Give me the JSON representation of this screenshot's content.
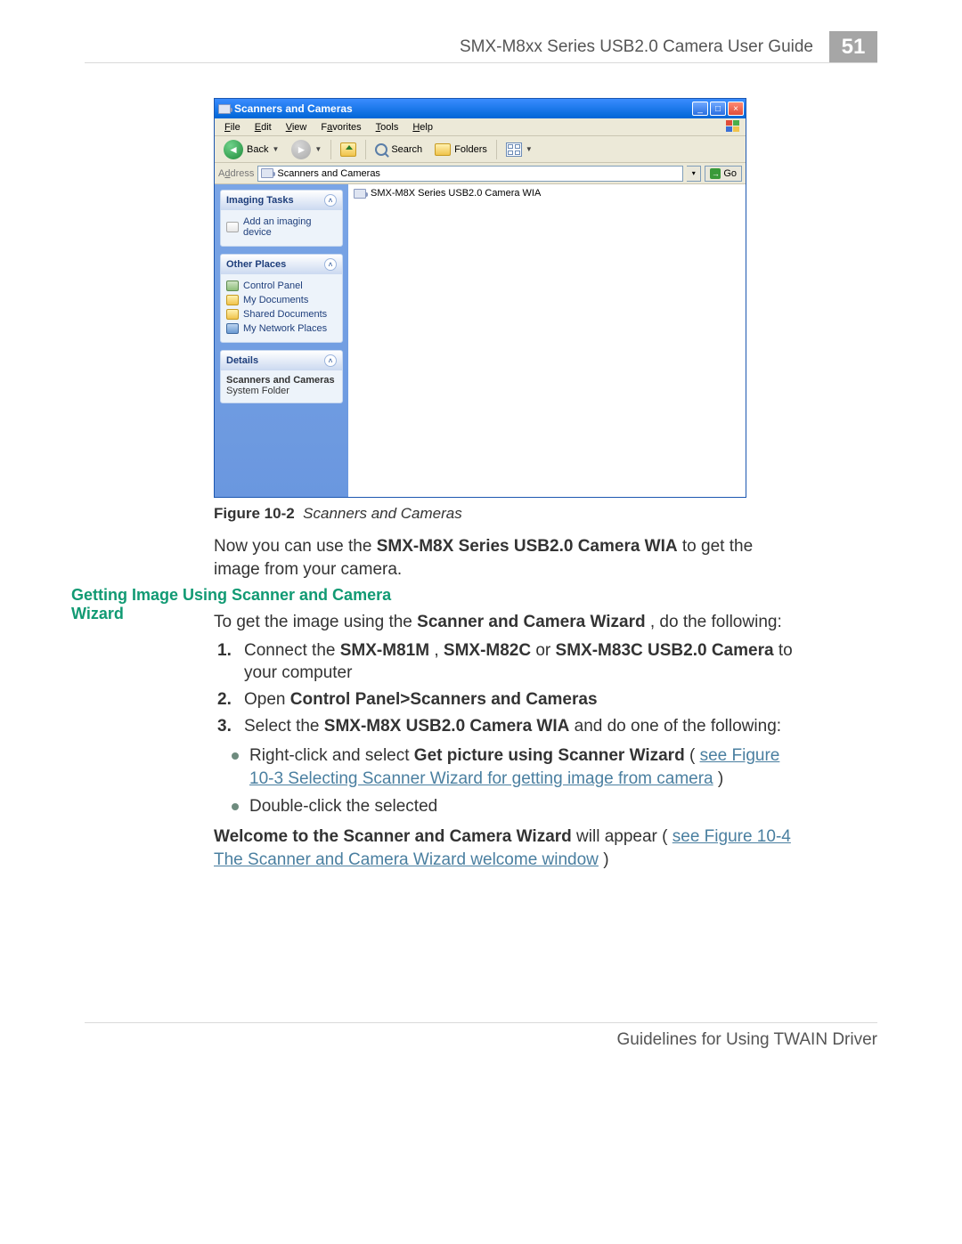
{
  "header": {
    "doc_title": "SMX-M8xx Series USB2.0 Camera User Guide",
    "page_number": "51"
  },
  "footer": {
    "text": "Guidelines for Using TWAIN Driver"
  },
  "section_heading": {
    "getting_image": "Getting Image Using Scanner and Camera Wizard"
  },
  "figure": {
    "label": "Figure 10-2",
    "caption": "Scanners and Cameras"
  },
  "para": {
    "now_use_pre": "Now you can use the ",
    "now_use_bold": "SMX-M8X Series USB2.0 Camera WIA",
    "now_use_post": " to get the image from your camera.",
    "intro_pre": "To get the image using the ",
    "intro_bold": "Scanner and Camera Wizard",
    "intro_post": ", do the following:",
    "welcome_bold": "Welcome to the Scanner and Camera Wizard",
    "welcome_mid": " will appear (",
    "welcome_link": "see Figure 10-4 The Scanner and Camera Wizard welcome window",
    "welcome_end": ")"
  },
  "steps": {
    "s1_pre": "Connect the ",
    "s1_b1": "SMX-M81M",
    "s1_sep1": ", ",
    "s1_b2": "SMX-M82C",
    "s1_sep2": " or ",
    "s1_b3": "SMX-M83C USB2.0 Camera",
    "s1_post": " to your computer",
    "s2_pre": "Open ",
    "s2_bold": "Control Panel>Scanners and Cameras",
    "s3_pre": "Select the ",
    "s3_bold": "SMX-M8X USB2.0 Camera WIA",
    "s3_post": " and do one of the following:"
  },
  "bullets": {
    "b1_pre": "Right-click and select ",
    "b1_bold": "Get picture using Scanner Wizard",
    "b1_mid": " (",
    "b1_link": "see Figure 10-3 Selecting Scanner Wizard for getting image from camera",
    "b1_end": ")",
    "b2": "Double-click the selected"
  },
  "xp": {
    "title": "Scanners and Cameras",
    "menus": {
      "file": "File",
      "edit": "Edit",
      "view": "View",
      "favorites": "Favorites",
      "tools": "Tools",
      "help": "Help"
    },
    "toolbar": {
      "back": "Back",
      "search": "Search",
      "folders": "Folders"
    },
    "address": {
      "label": "Address",
      "value": "Scanners and Cameras",
      "go": "Go"
    },
    "sidebar": {
      "imaging_title": "Imaging Tasks",
      "imaging_add": "Add an imaging device",
      "other_title": "Other Places",
      "other": {
        "cp": "Control Panel",
        "mydocs": "My Documents",
        "shared": "Shared Documents",
        "net": "My Network Places"
      },
      "details_title": "Details",
      "details_name": "Scanners and Cameras",
      "details_type": "System Folder"
    },
    "main_item": "SMX-M8X Series USB2.0 Camera WIA"
  }
}
